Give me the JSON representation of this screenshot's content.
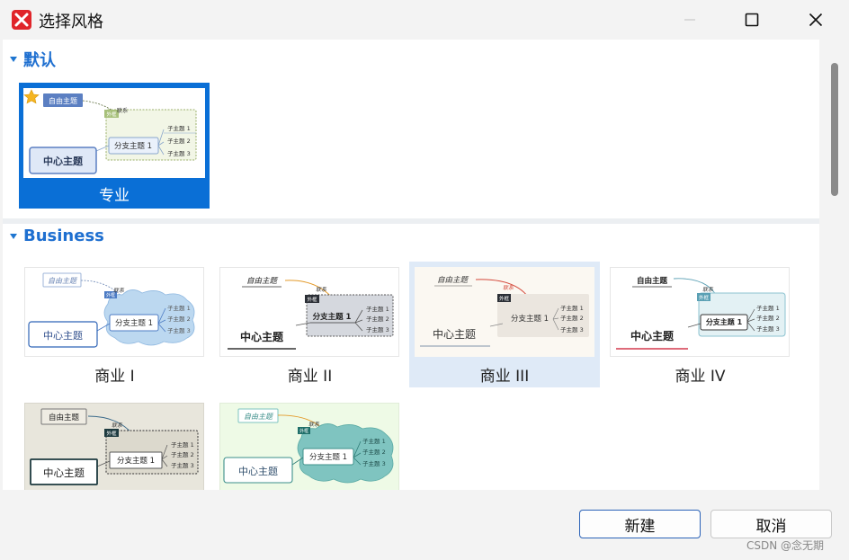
{
  "window": {
    "title": "选择风格",
    "controls": [
      "minimize",
      "maximize",
      "close"
    ]
  },
  "sections": [
    {
      "title": "默认",
      "styles": [
        {
          "label": "专业",
          "selected": true,
          "favorite": true,
          "preview": {
            "central": "中心主题",
            "branch": "分支主题 1",
            "floating": "自由主题",
            "relation": "联系",
            "boundary": "外框",
            "subs": [
              "子主题 1",
              "子主题 2",
              "子主题 3"
            ]
          }
        }
      ]
    },
    {
      "title": "Business",
      "styles": [
        {
          "label": "商业 I",
          "selected": false,
          "preview": {
            "central": "中心主题",
            "branch": "分支主题 1",
            "floating": "自由主题",
            "relation": "联系",
            "boundary": "外框",
            "subs": [
              "子主题 1",
              "子主题 2",
              "子主题 3"
            ]
          }
        },
        {
          "label": "商业 II",
          "selected": false,
          "preview": {
            "central": "中心主题",
            "branch": "分支主题 1",
            "floating": "自由主题",
            "relation": "联系",
            "boundary": "外框",
            "subs": [
              "子主题 1",
              "子主题 2",
              "子主题 3"
            ]
          }
        },
        {
          "label": "商业 III",
          "selected": false,
          "hovered": true,
          "preview": {
            "central": "中心主题",
            "branch": "分支主题 1",
            "floating": "自由主题",
            "relation": "联系",
            "boundary": "外框",
            "subs": [
              "子主题 1",
              "子主题 2",
              "子主题 3"
            ]
          }
        },
        {
          "label": "商业 IV",
          "selected": false,
          "preview": {
            "central": "中心主题",
            "branch": "分支主题 1",
            "floating": "自由主题",
            "relation": "联系",
            "boundary": "外框",
            "subs": [
              "子主题 1",
              "子主题 2",
              "子主题 3"
            ]
          }
        },
        {
          "label": "",
          "selected": false,
          "preview": {
            "central": "中心主题",
            "branch": "分支主题 1",
            "floating": "自由主题",
            "relation": "联系",
            "boundary": "外框",
            "subs": [
              "子主题 1",
              "子主题 2",
              "子主题 3"
            ]
          }
        },
        {
          "label": "",
          "selected": false,
          "preview": {
            "central": "中心主题",
            "branch": "分支主题 1",
            "floating": "自由主题",
            "relation": "联系",
            "boundary": "外框",
            "subs": [
              "子主题 1",
              "子主题 2",
              "子主题 3"
            ]
          }
        }
      ]
    }
  ],
  "footer": {
    "create_label": "新建",
    "cancel_label": "取消",
    "watermark": "CSDN @念无期"
  },
  "colors": {
    "accent": "#0a6fd6",
    "section_title": "#1e6fd0",
    "hover_bg": "#dfeaf7"
  }
}
